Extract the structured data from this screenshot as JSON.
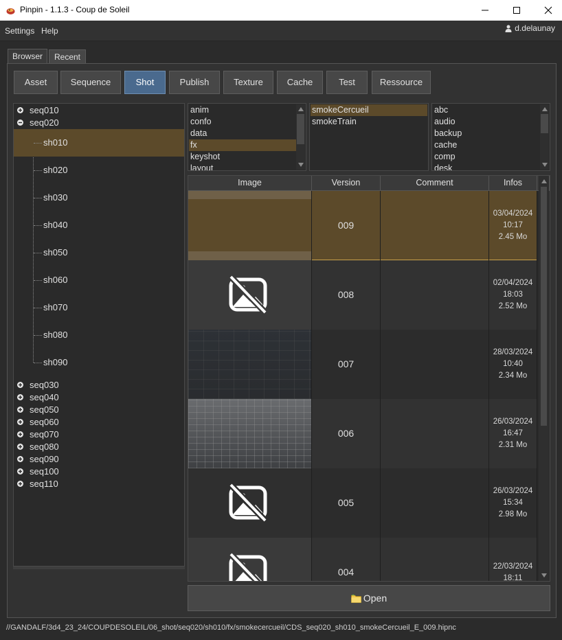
{
  "window": {
    "title": "Pinpin - 1.1.3 - Coup de Soleil",
    "controls": [
      "minimize-icon",
      "maximize-icon",
      "close-icon"
    ]
  },
  "menu": {
    "items": [
      "Settings",
      "Help"
    ],
    "user": "d.delaunay"
  },
  "tabs": [
    "Browser",
    "Recent"
  ],
  "categories": [
    "Asset",
    "Sequence",
    "Shot",
    "Publish",
    "Texture",
    "Cache",
    "Test",
    "Ressource"
  ],
  "selected_category": "Shot",
  "tree": {
    "sequences_before": [
      "seq010"
    ],
    "open_sequence": "seq020",
    "shots": [
      "sh010",
      "sh020",
      "sh030",
      "sh040",
      "sh050",
      "sh060",
      "sh070",
      "sh080",
      "sh090"
    ],
    "selected_shot": "sh010",
    "sequences_after": [
      "seq030",
      "seq040",
      "seq050",
      "seq060",
      "seq070",
      "seq080",
      "seq090",
      "seq100",
      "seq110"
    ]
  },
  "departments": {
    "items": [
      "anim",
      "confo",
      "data",
      "fx",
      "keyshot",
      "layout"
    ],
    "selected": "fx"
  },
  "assets": {
    "items": [
      "smokeCercueil",
      "smokeTrain"
    ],
    "selected": "smokeCercueil"
  },
  "formats": {
    "items": [
      "abc",
      "audio",
      "backup",
      "cache",
      "comp",
      "desk"
    ]
  },
  "table": {
    "headers": [
      "Image",
      "Version",
      "Comment",
      "Infos"
    ],
    "rows": [
      {
        "version": "009",
        "comment": "",
        "date": "03/04/2024",
        "time": "10:17",
        "size": "2.45 Mo",
        "image": "thumbnail",
        "selected": true
      },
      {
        "version": "008",
        "comment": "",
        "date": "02/04/2024",
        "time": "18:03",
        "size": "2.52 Mo",
        "image": "no-image-icon",
        "selected": false
      },
      {
        "version": "007",
        "comment": "",
        "date": "28/03/2024",
        "time": "10:40",
        "size": "2.34 Mo",
        "image": "thumbnail",
        "selected": false
      },
      {
        "version": "006",
        "comment": "",
        "date": "26/03/2024",
        "time": "16:47",
        "size": "2.31 Mo",
        "image": "thumbnail",
        "selected": false
      },
      {
        "version": "005",
        "comment": "",
        "date": "26/03/2024",
        "time": "15:34",
        "size": "2.98 Mo",
        "image": "no-image-icon",
        "selected": false
      },
      {
        "version": "004",
        "comment": "",
        "date": "22/03/2024",
        "time": "18:11",
        "size": "",
        "image": "no-image-icon",
        "selected": false
      }
    ]
  },
  "open_button": "Open",
  "status_path": "//GANDALF/3d4_23_24/COUPDESOLEIL/06_shot/seq020/sh010/fx/smokecercueil/CDS_seq020_sh010_smokeCercueil_E_009.hipnc",
  "colors": {
    "selection": "#5c4a2a",
    "selected_button": "#4a6a8e",
    "background": "#2b2b2b"
  }
}
